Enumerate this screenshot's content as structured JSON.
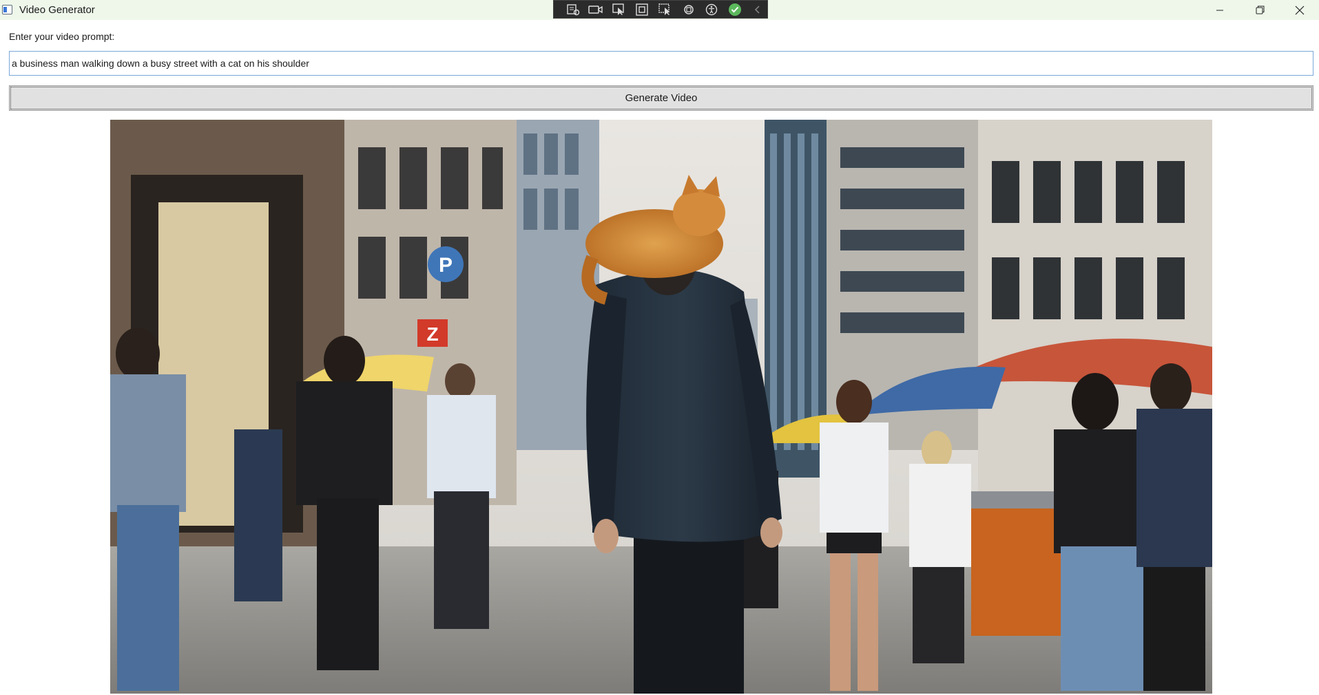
{
  "window": {
    "title": "Video Generator",
    "controls": [
      "minimize",
      "restore",
      "close"
    ]
  },
  "debug_toolbar": {
    "icons": [
      "live-visual-tree-icon",
      "video-icon",
      "select-element-icon",
      "display-layout-adorners-icon",
      "track-focused-element-icon",
      "hot-reload-icon",
      "accessibility-icon",
      "checkmark-icon",
      "collapse-chevron-icon"
    ]
  },
  "prompt": {
    "label": "Enter your video prompt:",
    "value": "a business man walking down a busy street with a cat on his shoulder"
  },
  "generate_button": {
    "label": "Generate Video"
  },
  "video": {
    "scene_elements": [
      "business man in dark suit seen from behind",
      "orange cat on shoulder",
      "busy city street",
      "pedestrians",
      "market umbrellas",
      "parking sign P",
      "sign Z"
    ],
    "sign_p": "P",
    "sign_z": "Z"
  }
}
